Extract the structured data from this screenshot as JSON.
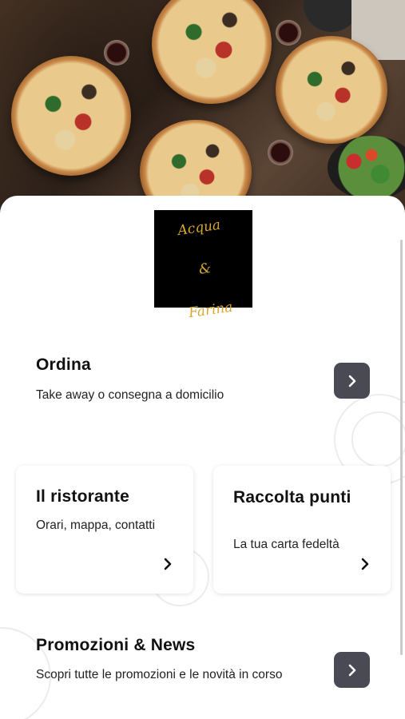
{
  "logo": {
    "line1": "Acqua",
    "line2": "&",
    "line3": "Farina"
  },
  "order": {
    "title": "Ordina",
    "subtitle": "Take away o consegna a domicilio",
    "icon": "chevron-right-icon"
  },
  "restaurant": {
    "title": "Il ristorante",
    "subtitle": "Orari, mappa, contatti",
    "icon": "chevron-right-icon"
  },
  "loyalty": {
    "title": "Raccolta punti",
    "subtitle": "La tua carta fedeltà",
    "icon": "chevron-right-icon"
  },
  "promo": {
    "title": "Promozioni & News",
    "subtitle": "Scopri tutte le promozioni e le novità in corso",
    "icon": "chevron-right-icon"
  },
  "colors": {
    "button_bg": "#4a4a55",
    "logo_bg": "#000000",
    "logo_gold": "#d6a72e"
  }
}
